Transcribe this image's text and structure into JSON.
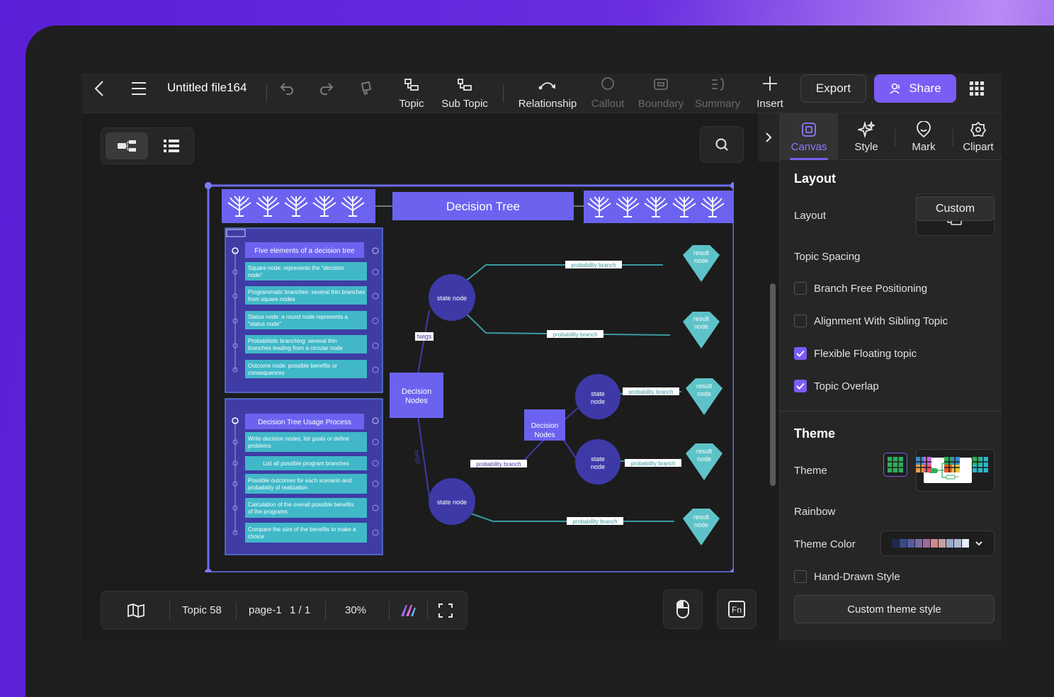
{
  "toolbar": {
    "title": "Untitled file164",
    "tools": [
      {
        "label": "Topic",
        "icon": "topic-icon",
        "enabled": true
      },
      {
        "label": "Sub Topic",
        "icon": "subtopic-icon",
        "enabled": true
      },
      {
        "label": "Relationship",
        "icon": "relationship-icon",
        "enabled": true
      },
      {
        "label": "Callout",
        "icon": "callout-icon",
        "enabled": false
      },
      {
        "label": "Boundary",
        "icon": "boundary-icon",
        "enabled": false
      },
      {
        "label": "Summary",
        "icon": "summary-icon",
        "enabled": false
      },
      {
        "label": "Insert",
        "icon": "plus-icon",
        "enabled": true
      }
    ],
    "export_label": "Export",
    "share_label": "Share"
  },
  "diagram": {
    "title": "Decision Tree",
    "card1": {
      "title": "Five elements of a decision tree",
      "items": [
        "Square node: represents the \"decision node\"",
        "Programmatic branches: several thin branches from square nodes",
        "Status node: a round node represents a \"status node\"",
        "Probabilistic branching: several thin branches leading from a circular node",
        "Outcome node: possible benefits or consequences"
      ]
    },
    "card2": {
      "title": "Decision Tree Usage Process",
      "items": [
        "Write decision nodes, list goals or define problems",
        "List all possible program branches",
        "Possible outcomes for each scenario and probability of realization",
        "Calculation of the overall possible benefits of the programs",
        "Compare the size of the benefits to make a choice"
      ]
    },
    "decision_nodes_label": "Decision Nodes",
    "state_node_label": "state node",
    "result_node_label": "result node",
    "twigs_label": "twigs",
    "probability_branch_label": "probability branch",
    "colors": {
      "accent": "#6b63f0",
      "node": "#3d3aa8",
      "result": "#5ec3c8",
      "card": "#3f3ca6",
      "frame": "#6c6cf0"
    }
  },
  "statusbar": {
    "topic_count": "Topic 58",
    "page": "page-1",
    "page_num": "1 / 1",
    "zoom": "30%"
  },
  "panel": {
    "tabs": [
      {
        "label": "Canvas",
        "icon": "canvas-icon",
        "active": true
      },
      {
        "label": "Style",
        "icon": "sparkle-icon",
        "active": false
      },
      {
        "label": "Mark",
        "icon": "smiley-icon",
        "active": false
      },
      {
        "label": "Clipart",
        "icon": "clipart-icon",
        "active": false
      }
    ],
    "layout_section": "Layout",
    "layout_label": "Layout",
    "topic_spacing_label": "Topic Spacing",
    "topic_spacing_value": "Custom",
    "options": [
      {
        "label": "Branch Free Positioning",
        "checked": false
      },
      {
        "label": "Alignment With Sibling Topic",
        "checked": false
      },
      {
        "label": "Flexible Floating topic",
        "checked": true
      },
      {
        "label": "Topic Overlap",
        "checked": true
      }
    ],
    "theme_section": "Theme",
    "theme_label": "Theme",
    "rainbow_label": "Rainbow",
    "theme_color_label": "Theme Color",
    "theme_swatches": [
      "#1e2a4a",
      "#3a4a8a",
      "#5a5aa0",
      "#7a6aa8",
      "#a06a9a",
      "#d08a8a",
      "#c8a0a0",
      "#9aaac8",
      "#b0b8d0",
      "#e8eef8"
    ],
    "hand_drawn_label": "Hand-Drawn Style",
    "hand_drawn_checked": false,
    "custom_theme_label": "Custom theme style"
  }
}
